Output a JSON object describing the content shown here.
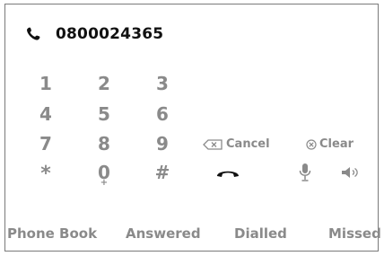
{
  "dialer": {
    "number": "0800024365"
  },
  "keypad": {
    "keys": [
      {
        "label": "1"
      },
      {
        "label": "2"
      },
      {
        "label": "3"
      },
      {
        "label": "4"
      },
      {
        "label": "5"
      },
      {
        "label": "6"
      },
      {
        "label": "7"
      },
      {
        "label": "8"
      },
      {
        "label": "9"
      },
      {
        "label": "*"
      },
      {
        "label": "0",
        "sub": "+"
      },
      {
        "label": "#"
      }
    ]
  },
  "actions": {
    "cancel": "Cancel",
    "clear": "Clear"
  },
  "icons": {
    "phone": "phone-icon",
    "backspace": "backspace-icon",
    "clear": "clear-icon",
    "hangup": "hangup-icon",
    "mic": "microphone-icon",
    "speaker": "speaker-icon"
  },
  "tabs": [
    "Phone Book",
    "Answered",
    "Dialled",
    "Missed"
  ],
  "colors": {
    "text_dark": "#111111",
    "text_muted": "#8a8a8a",
    "hangup": "#111111",
    "border": "#7a7a7a"
  }
}
